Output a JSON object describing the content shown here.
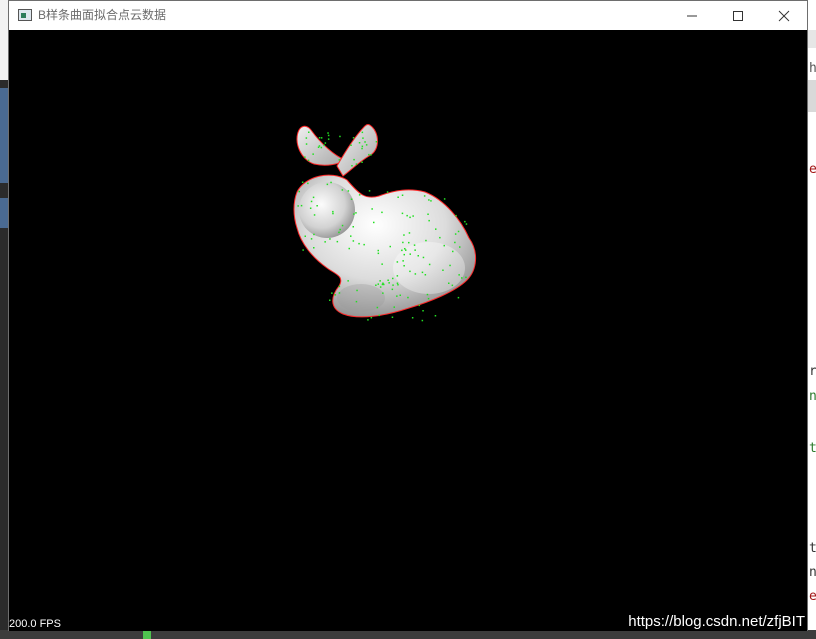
{
  "window": {
    "title": "B样条曲面拟合点云数据",
    "minimize_icon": "minimize-icon",
    "maximize_icon": "maximize-icon",
    "close_icon": "close-icon",
    "app_icon": "app-window-icon"
  },
  "viewport": {
    "fps": "200.0 FPS",
    "watermark": "https://blog.csdn.net/zfjBIT",
    "background_color": "#000000",
    "surface_color": "#d9d9d9",
    "boundary_color": "#ff2a2a",
    "points_color": "#22e022"
  },
  "background_editor": {
    "glyphs": [
      "h",
      "e",
      "r",
      "n",
      "t",
      "t",
      "n",
      "e"
    ]
  }
}
